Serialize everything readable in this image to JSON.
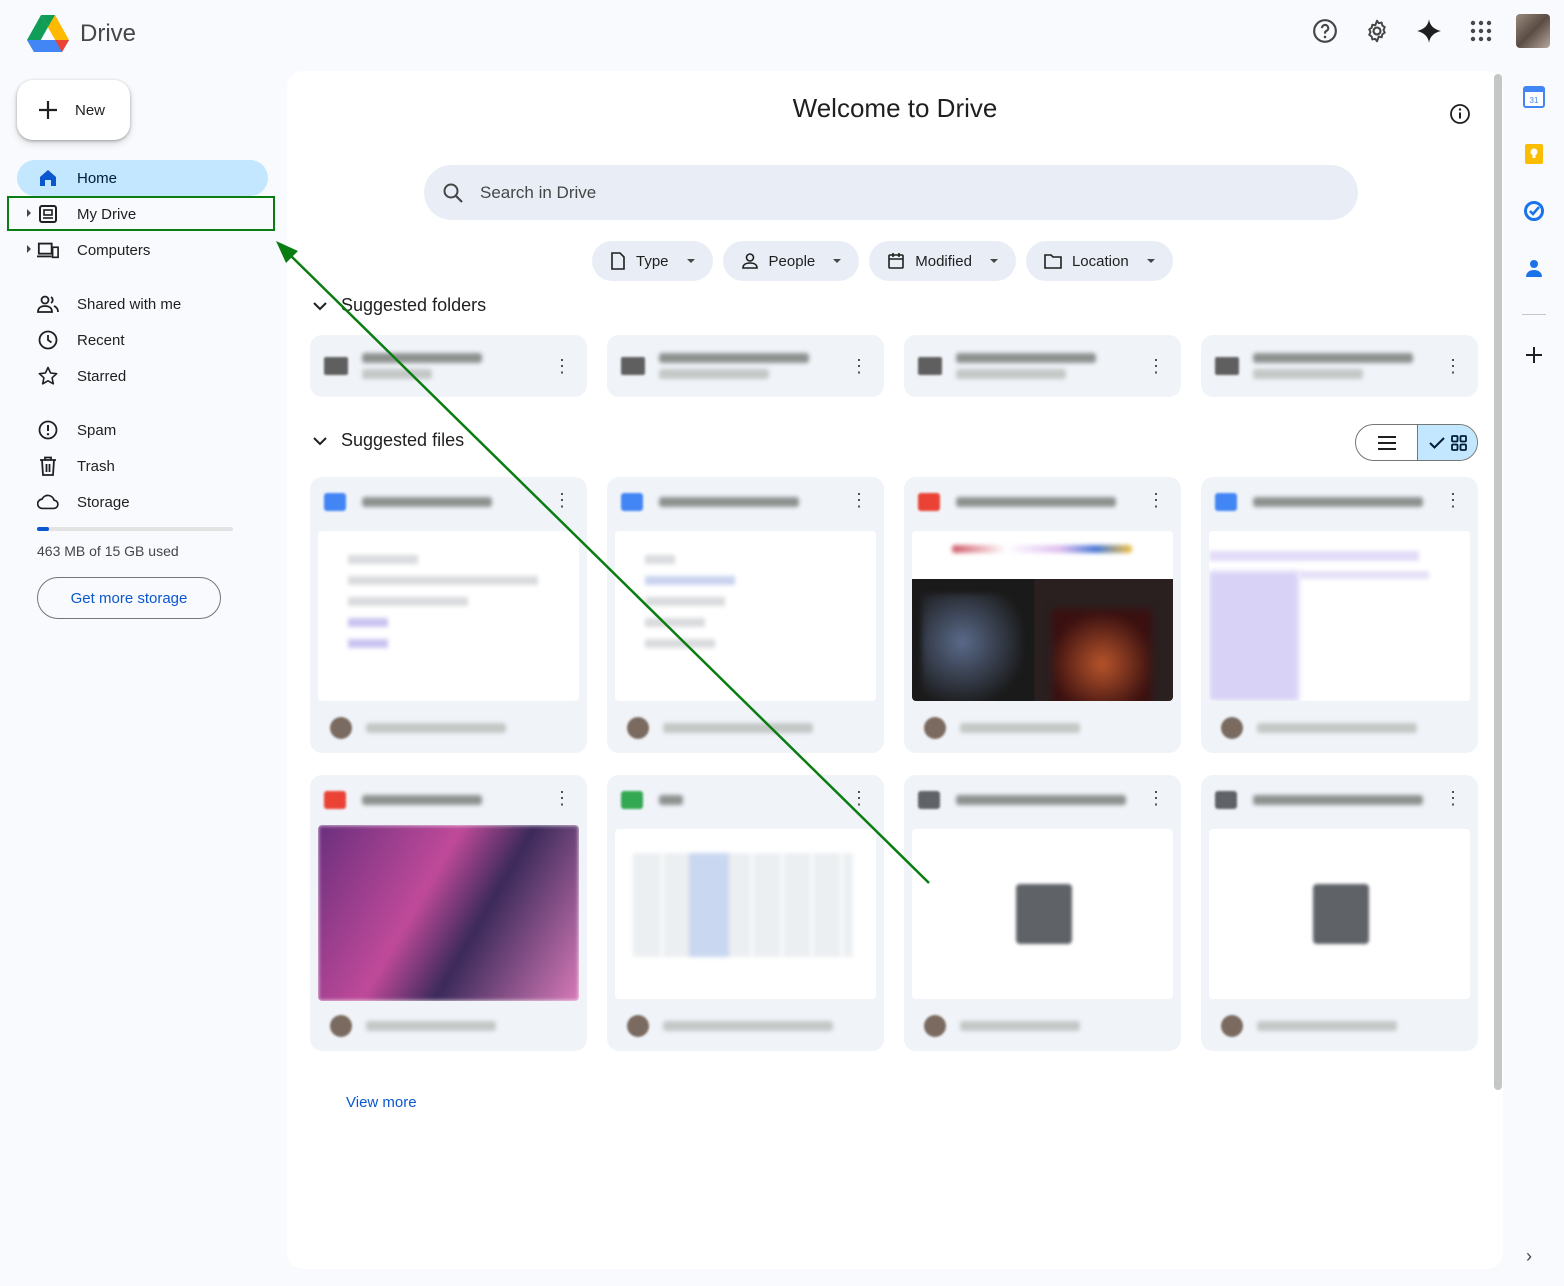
{
  "app": {
    "name": "Drive"
  },
  "topbar": {
    "icons": [
      "help-icon",
      "settings-icon",
      "gemini-sparkle-icon",
      "apps-grid-icon",
      "account-avatar"
    ]
  },
  "sidebar": {
    "new_label": "New",
    "items": [
      {
        "label": "Home",
        "icon": "home-icon",
        "active": true
      },
      {
        "label": "My Drive",
        "icon": "my-drive-icon",
        "expandable": true
      },
      {
        "label": "Computers",
        "icon": "computers-icon",
        "expandable": true
      },
      {
        "label": "Shared with me",
        "icon": "people-icon"
      },
      {
        "label": "Recent",
        "icon": "clock-icon"
      },
      {
        "label": "Starred",
        "icon": "star-icon"
      },
      {
        "label": "Spam",
        "icon": "spam-icon"
      },
      {
        "label": "Trash",
        "icon": "trash-icon"
      },
      {
        "label": "Storage",
        "icon": "cloud-icon"
      }
    ],
    "storage": {
      "used_text": "463 MB of 15 GB used",
      "fraction_used": 0.03,
      "button_label": "Get more storage"
    }
  },
  "main": {
    "title": "Welcome to Drive",
    "search": {
      "placeholder": "Search in Drive"
    },
    "filters": [
      {
        "label": "Type",
        "icon": "file-icon"
      },
      {
        "label": "People",
        "icon": "person-icon"
      },
      {
        "label": "Modified",
        "icon": "calendar-icon"
      },
      {
        "label": "Location",
        "icon": "folder-icon"
      }
    ],
    "suggested_folders_title": "Suggested folders",
    "suggested_files_title": "Suggested files",
    "folders_count_visible": 4,
    "files": [
      {
        "type": "doc",
        "color": "#4285f4"
      },
      {
        "type": "doc",
        "color": "#4285f4"
      },
      {
        "type": "image",
        "color": "#ea4335"
      },
      {
        "type": "doc",
        "color": "#4285f4"
      },
      {
        "type": "image",
        "color": "#ea4335"
      },
      {
        "type": "sheet",
        "color": "#34a853"
      },
      {
        "type": "zip",
        "color": "#5f6368"
      },
      {
        "type": "zip",
        "color": "#5f6368"
      }
    ],
    "view_more_label": "View more"
  },
  "annotation": {
    "highlight_target": "My Drive",
    "color": "#0a7d12"
  },
  "right_rail": {
    "icons": [
      "calendar-app-icon",
      "keep-app-icon",
      "tasks-app-icon",
      "contacts-app-icon",
      "add-app-icon"
    ]
  }
}
